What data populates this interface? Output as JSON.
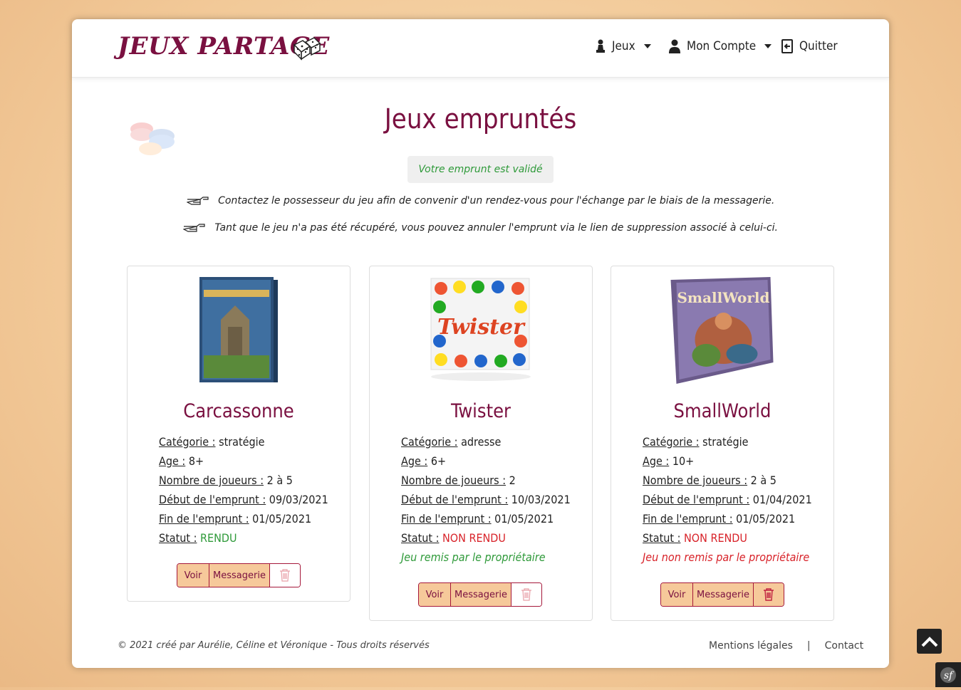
{
  "navbar": {
    "logo": "Jeux partage",
    "menu_jeux": "Jeux",
    "menu_compte": "Mon Compte",
    "menu_quitter": "Quitter"
  },
  "page": {
    "title": "Jeux empruntés",
    "alert": "Votre emprunt est validé",
    "info1": "Contactez le possesseur du jeu afin de convenir d'un rendez-vous pour l'échange par le biais de la messagerie.",
    "info2": "Tant que le jeu n'a pas été récupéré, vous pouvez annuler l'emprunt via le lien de suppression associé à celui-ci."
  },
  "labels": {
    "categorie": "Catégorie :",
    "age": "Age :",
    "joueurs": "Nombre de joueurs :",
    "debut": "Début de l'emprunt :",
    "fin": "Fin de l'emprunt :",
    "statut": "Statut :",
    "voir": "Voir",
    "messagerie": "Messagerie"
  },
  "cards": [
    {
      "name": "Carcassonne",
      "categorie": "stratégie",
      "age": "8+",
      "joueurs": "2 à 5",
      "debut": "09/03/2021",
      "fin": "01/05/2021",
      "statut": "RENDU",
      "remis": ""
    },
    {
      "name": "Twister",
      "categorie": "adresse",
      "age": "6+",
      "joueurs": "2",
      "debut": "10/03/2021",
      "fin": "01/05/2021",
      "statut": "NON RENDU",
      "remis": "Jeu remis par le propriétaire"
    },
    {
      "name": "SmallWorld",
      "categorie": "stratégie",
      "age": "10+",
      "joueurs": "2 à 5",
      "debut": "01/04/2021",
      "fin": "01/05/2021",
      "statut": "NON RENDU",
      "remis": "Jeu non remis par le propriétaire"
    }
  ],
  "footer": {
    "copyright": "© 2021 créé par Aurélie, Céline et Véronique - Tous droits réservés",
    "mentions": "Mentions légales",
    "separator": "|",
    "contact": "Contact"
  },
  "colors": {
    "brand": "#7a1040",
    "button_bg": "#f6c99a",
    "green": "#2f9a3a",
    "red": "#d8232a"
  }
}
